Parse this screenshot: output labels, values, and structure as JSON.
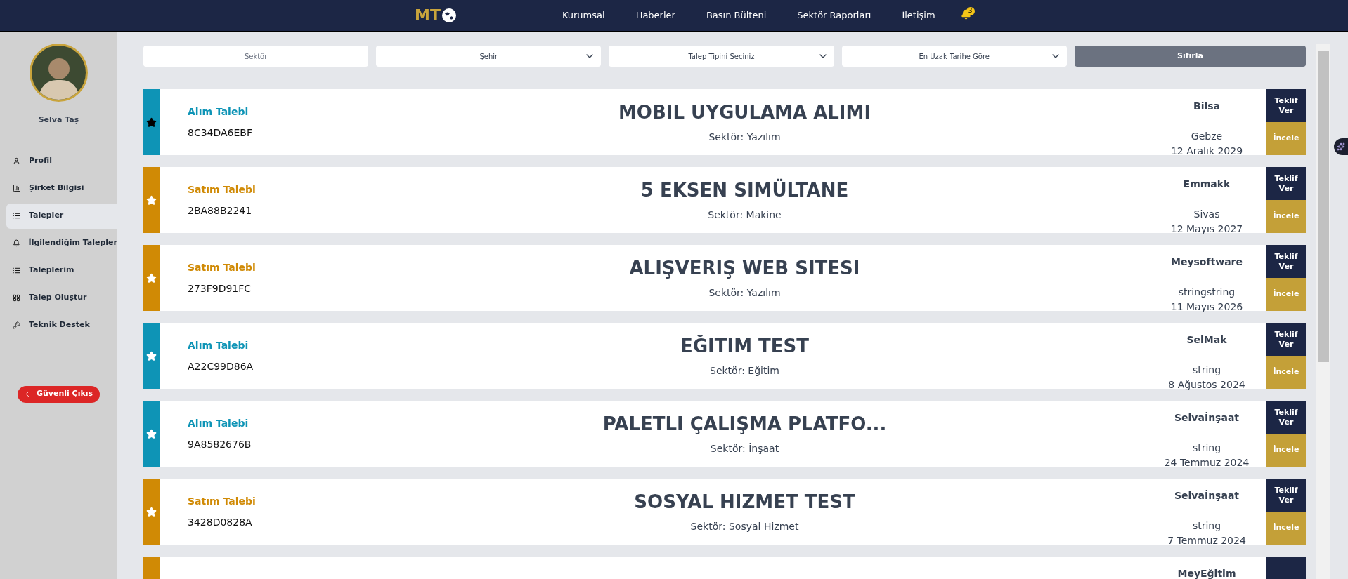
{
  "navbar": {
    "logo": "MT",
    "links": [
      "Kurumsal",
      "Haberler",
      "Basın Bülteni",
      "Sektör Raporları",
      "İletişim"
    ],
    "notification_count": "3"
  },
  "sidebar": {
    "user_name": "Selva Taş",
    "items": [
      {
        "label": "Profil",
        "selected": false
      },
      {
        "label": "Şirket Bilgisi",
        "selected": false
      },
      {
        "label": "Talepler",
        "selected": true
      },
      {
        "label": "İlgilendiğim Talepler",
        "selected": false
      },
      {
        "label": "Taleplerim",
        "selected": false
      },
      {
        "label": "Talep Oluştur",
        "selected": false
      },
      {
        "label": "Teknik Destek",
        "selected": false
      }
    ],
    "logout": "Güvenli Çıkış"
  },
  "filters": {
    "sector": {
      "placeholder": "Sektör"
    },
    "selects": [
      "Şehir",
      "Talep Tipini Seçiniz",
      "En Uzak Tarihe Göre"
    ],
    "reset": "Sıfırla"
  },
  "requests": [
    {
      "kind": "alim",
      "favorite": true,
      "type_label": "Alım Talebi",
      "code": "8C34DA6EBF",
      "title": "MOBIL UYGULAMA ALIMI",
      "sector": "Sektör: Yazılım",
      "company": "Bilsa",
      "city": "Gebze",
      "date": "12 Aralık 2029",
      "offer": "Teklif Ver",
      "view": "İncele"
    },
    {
      "kind": "satim",
      "favorite": false,
      "type_label": "Satım Talebi",
      "code": "2BA88B2241",
      "title": "5 EKSEN SIMÜLTANE",
      "sector": "Sektör: Makine",
      "company": "Emmakk",
      "city": "Sivas",
      "date": "12 Mayıs 2027",
      "offer": "Teklif Ver",
      "view": "İncele"
    },
    {
      "kind": "satim",
      "favorite": false,
      "type_label": "Satım Talebi",
      "code": "273F9D91FC",
      "title": "ALIŞVERIŞ WEB SITESI",
      "sector": "Sektör: Yazılım",
      "company": "Meysoftware",
      "city": "stringstring",
      "date": "11 Mayıs 2026",
      "offer": "Teklif Ver",
      "view": "İncele"
    },
    {
      "kind": "alim",
      "favorite": false,
      "type_label": "Alım Talebi",
      "code": "A22C99D86A",
      "title": "EĞITIM TEST",
      "sector": "Sektör: Eğitim",
      "company": "SelMak",
      "city": "string",
      "date": "8 Ağustos 2024",
      "offer": "Teklif Ver",
      "view": "İncele"
    },
    {
      "kind": "alim",
      "favorite": false,
      "type_label": "Alım Talebi",
      "code": "9A8582676B",
      "title": "PALETLI ÇALIŞMA PLATFO...",
      "sector": "Sektör: İnşaat",
      "company": "Selvaİnşaat",
      "city": "string",
      "date": "24 Temmuz 2024",
      "offer": "Teklif Ver",
      "view": "İncele"
    },
    {
      "kind": "satim",
      "favorite": false,
      "type_label": "Satım Talebi",
      "code": "3428D0828A",
      "title": "SOSYAL HIZMET TEST",
      "sector": "Sektör: Sosyal Hizmet",
      "company": "Selvaİnşaat",
      "city": "string",
      "date": "7 Temmuz 2024",
      "offer": "Teklif Ver",
      "view": "İncele"
    },
    {
      "kind": "satim",
      "company": "MeyEğitim"
    }
  ]
}
